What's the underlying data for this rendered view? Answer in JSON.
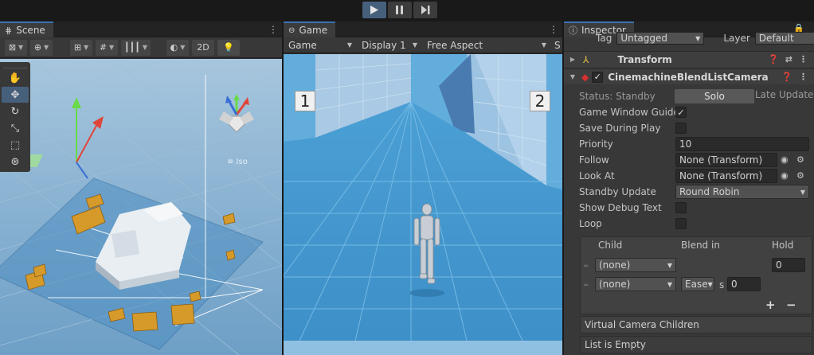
{
  "toolbar": {
    "play": "play-icon",
    "pause": "pause-icon",
    "step": "step-icon"
  },
  "scene": {
    "tab": "Scene",
    "tools": {
      "mode_2d": "2D"
    },
    "left_tools": [
      "hand-icon",
      "move-icon",
      "rotate-icon",
      "scale-icon",
      "rect-icon",
      "transform-icon"
    ],
    "persp_label": "≡ Iso"
  },
  "game": {
    "tab": "Game",
    "view_select": "Game",
    "display": "Display 1",
    "aspect": "Free Aspect",
    "cam1": "1",
    "cam2": "2"
  },
  "inspector": {
    "tab": "Inspector",
    "tag_label": "Tag",
    "tag_value": "Untagged",
    "layer_label": "Layer",
    "layer_value": "Default",
    "transform_title": "Transform",
    "component_title": "CinemachineBlendListCamera",
    "status": "Status: Standby",
    "solo": "Solo",
    "late_update": "Late Update",
    "fields": {
      "game_window_guides": "Game Window Guides",
      "save_during_play": "Save During Play",
      "priority": "Priority",
      "priority_value": "10",
      "follow": "Follow",
      "follow_value": "None (Transform)",
      "look_at": "Look At",
      "look_at_value": "None (Transform)",
      "standby_update": "Standby Update",
      "standby_value": "Round Robin",
      "show_debug_text": "Show Debug Text",
      "loop": "Loop"
    },
    "blend_list": {
      "col_child": "Child",
      "col_blend": "Blend in",
      "col_hold": "Hold",
      "rows": [
        {
          "child": "(none)",
          "blend": "",
          "hold": "0"
        },
        {
          "child": "(none)",
          "blend": "Ease",
          "unit": "s",
          "hold": "0"
        }
      ],
      "plus": "+",
      "minus": "−"
    },
    "children_title": "Virtual Camera Children",
    "children_empty": "List is Empty"
  },
  "colors": {
    "accent": "#46607c",
    "tab_highlight": "#3a72b0",
    "sky": "#5aa8d8"
  }
}
